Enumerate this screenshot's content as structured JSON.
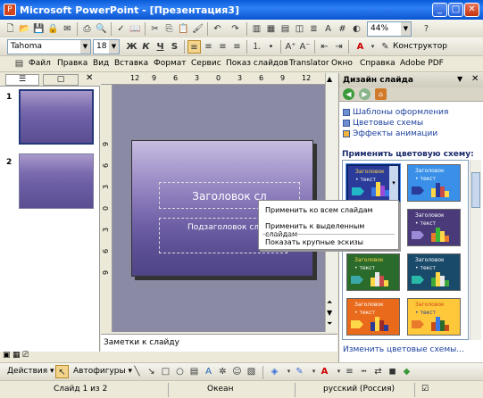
{
  "window": {
    "title": "Microsoft PowerPoint - [Презентация3]",
    "minimize": "_",
    "maximize": "□",
    "close": "✕"
  },
  "toolbar1": {
    "zoom": "44%",
    "help": "?"
  },
  "toolbar2": {
    "font": "Tahoma",
    "size": "18",
    "bold": "Ж",
    "italic": "К",
    "underline": "Ч",
    "shadow": "S",
    "designer": "Конструктор"
  },
  "menu": [
    "Файл",
    "Правка",
    "Вид",
    "Вставка",
    "Формат",
    "Сервис",
    "Показ слайдов",
    "Translator",
    "Окно",
    "Справка",
    "Adobe PDF"
  ],
  "thumbnails": [
    {
      "num": "1"
    },
    {
      "num": "2"
    }
  ],
  "ruler": {
    "h": [
      "12",
      "9",
      "6",
      "3",
      "0",
      "3",
      "6",
      "9",
      "12"
    ],
    "v": [
      "9",
      "6",
      "3",
      "0",
      "3",
      "6",
      "9"
    ]
  },
  "slide": {
    "title": "Заголовок сл",
    "subtitle": "Подзаголовок сл"
  },
  "notes_placeholder": "Заметки к слайду",
  "taskpane": {
    "title": "Дизайн слайда",
    "links": [
      "Шаблоны оформления",
      "Цветовые схемы",
      "Эффекты анимации"
    ],
    "scheme_label": "Применить цветовую схему:",
    "scheme_title": "Заголовок",
    "scheme_text": "• текст",
    "edit_link": "Изменить цветовые схемы..."
  },
  "context_menu": [
    "Применить ко всем слайдам",
    "Применить к выделенным слайдам",
    "Показать крупные эскизы"
  ],
  "drawbar": {
    "actions": "Действия ▾",
    "autoshapes": "Автофигуры ▾"
  },
  "status": {
    "slide": "Слайд 1 из 2",
    "theme": "Океан",
    "language": "русский (Россия)"
  },
  "colors": {
    "titlebar": "#0a5bd8",
    "slide_bg": "#7b6aae",
    "link": "#1a3f9c"
  }
}
